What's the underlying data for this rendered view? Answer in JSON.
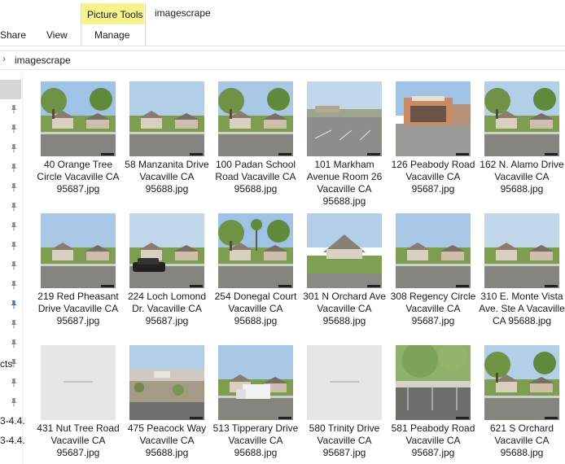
{
  "ribbon": {
    "context_title": "Picture Tools",
    "window_title": "imagescrape",
    "tabs": {
      "share": "Share",
      "view": "View",
      "manage": "Manage"
    },
    "context_color": "#f6f38e"
  },
  "address": {
    "path": "imagescrape"
  },
  "nav": {
    "labels": [
      {
        "text": "cts"
      },
      {
        "text": "3-4.4."
      },
      {
        "text": "3-4.4."
      }
    ]
  },
  "files": [
    {
      "name": "40 Orange Tree Circle Vacaville CA 95687.jpg",
      "thumb": "street-trees"
    },
    {
      "name": "58 Manzanita Drive Vacaville CA 95688.jpg",
      "thumb": "street-houses"
    },
    {
      "name": "100 Padan School Road Vacaville CA 95688.jpg",
      "thumb": "street-trees"
    },
    {
      "name": "101 Markham Avenue Room 26 Vacaville CA 95688.jpg",
      "thumb": "parking-lot"
    },
    {
      "name": "126 Peabody Road Vacaville CA 95687.jpg",
      "thumb": "storefront"
    },
    {
      "name": "162 N. Alamo Drive Vacaville CA 95688.jpg",
      "thumb": "street-trees"
    },
    {
      "name": "219 Red Pheasant Drive Vacaville CA 95687.jpg",
      "thumb": "street-houses"
    },
    {
      "name": "224 Loch Lomond Dr. Vacaville CA 95687.jpg",
      "thumb": "street-car"
    },
    {
      "name": "254 Donegal Court Vacaville CA 95688.jpg",
      "thumb": "street-palms"
    },
    {
      "name": "301 N Orchard Ave Vacaville CA 95688.jpg",
      "thumb": "church"
    },
    {
      "name": "308 Regency Circle Vacaville CA 95687.jpg",
      "thumb": "street-houses"
    },
    {
      "name": "310 E. Monte Vista Ave. Ste A Vacaville CA 95688.jpg",
      "thumb": "street-houses"
    },
    {
      "name": "431 Nut Tree Road Vacaville CA 95687.jpg",
      "thumb": "blank"
    },
    {
      "name": "475 Peacock Way Vacaville CA 95688.jpg",
      "thumb": "hillside"
    },
    {
      "name": "513 Tipperary Drive Vacaville CA 95688.jpg",
      "thumb": "street-truck"
    },
    {
      "name": "580 Trinity Drive Vacaville CA 95687.jpg",
      "thumb": "blank"
    },
    {
      "name": "581 Peabody Road Vacaville CA 95687.jpg",
      "thumb": "carport"
    },
    {
      "name": "621 S Orchard Vacaville CA 95688.jpg",
      "thumb": "street-trees"
    }
  ],
  "icons": {
    "pin": "pin-icon",
    "chevron": "chevron-right-icon"
  }
}
